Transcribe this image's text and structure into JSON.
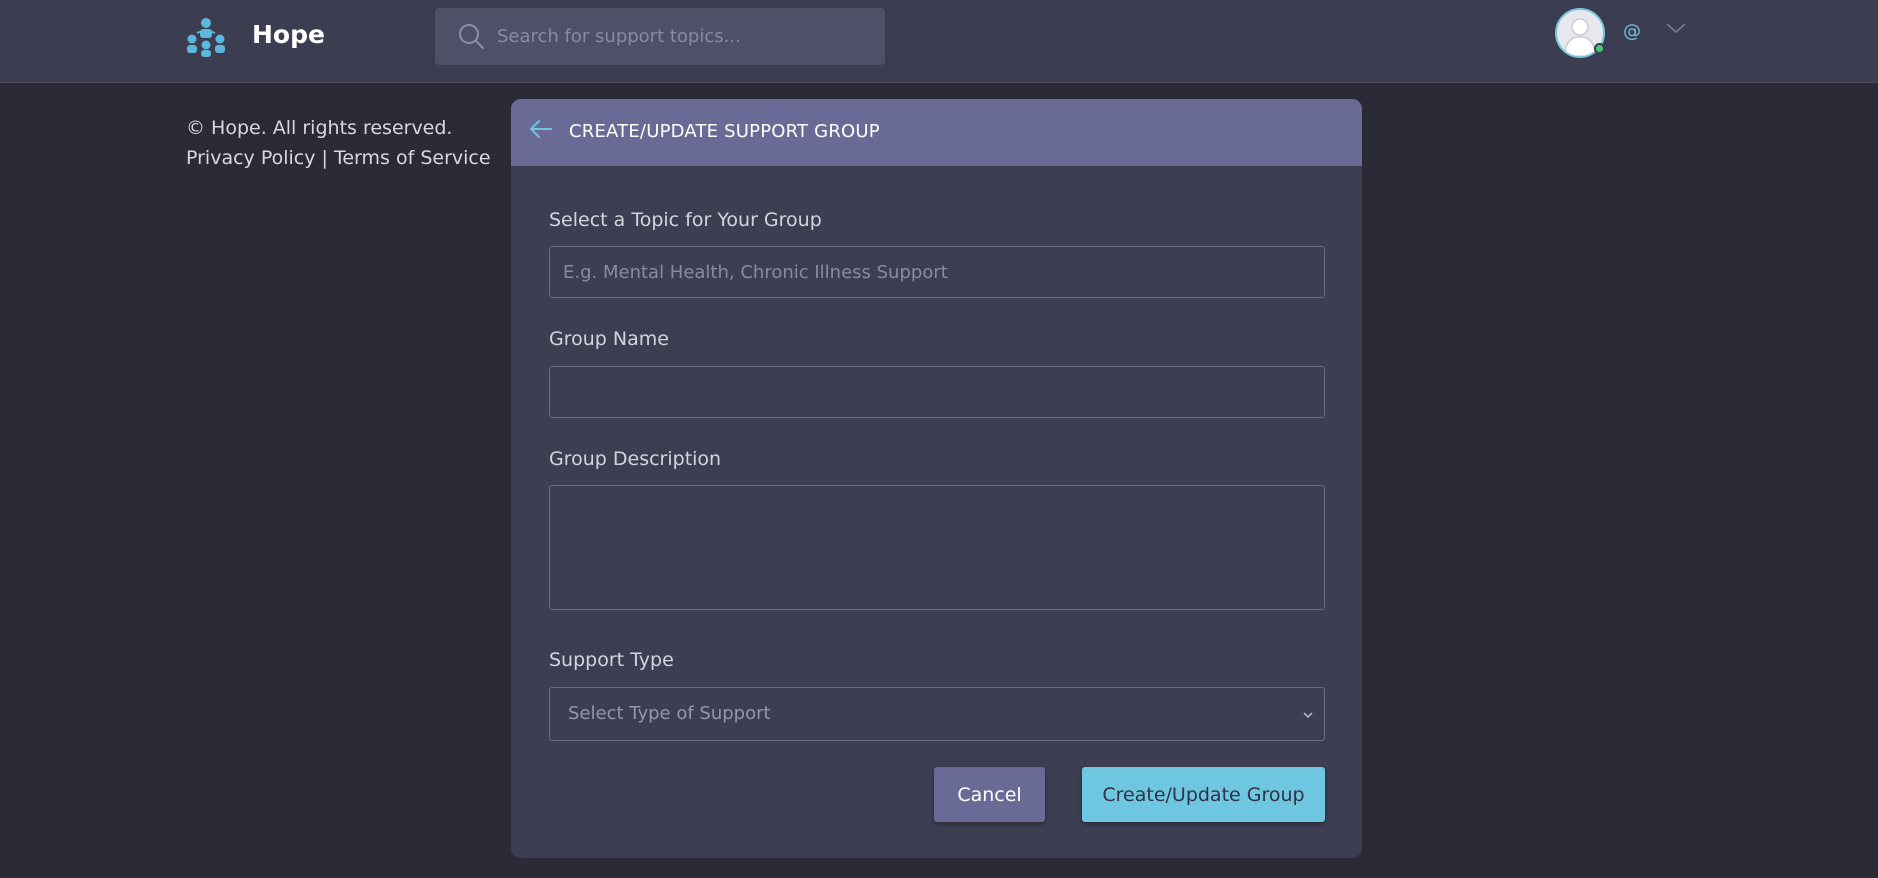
{
  "header": {
    "app_name": "Hope",
    "search_placeholder": "Search for support topics...",
    "user_handle": "@"
  },
  "footer": {
    "copyright": "© Hope. All rights reserved.",
    "privacy_label": "Privacy Policy",
    "separator": " | ",
    "terms_label": "Terms of Service"
  },
  "form": {
    "title": "CREATE/UPDATE SUPPORT GROUP",
    "topic_label": "Select a Topic for Your Group",
    "topic_placeholder": "E.g. Mental Health, Chronic Illness Support",
    "topic_value": "",
    "name_label": "Group Name",
    "name_value": "",
    "description_label": "Group Description",
    "description_value": "",
    "support_type_label": "Support Type",
    "support_type_selected": "Select Type of Support",
    "cancel_label": "Cancel",
    "submit_label": "Create/Update Group"
  },
  "colors": {
    "page_bg": "#2b2b37",
    "header_bg": "#3d3d52",
    "card_bg": "#3e3e53",
    "card_header_bg": "#6a6a96",
    "accent": "#6ec6e0",
    "online": "#48c774"
  },
  "icons": {
    "logo": "community-logo-icon",
    "search": "search-icon",
    "back": "arrow-left-icon",
    "menu": "chevron-down-icon",
    "select": "chevron-down-icon"
  }
}
